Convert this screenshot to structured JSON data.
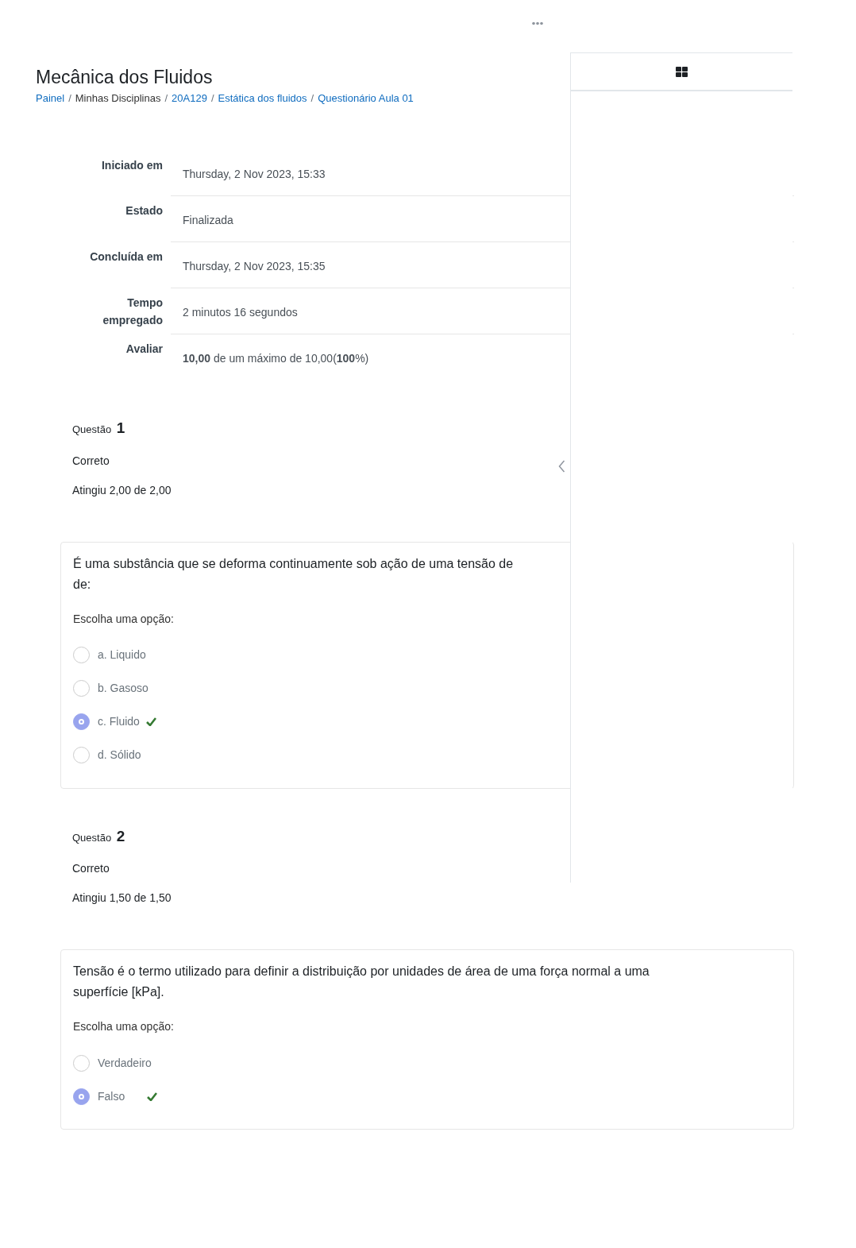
{
  "page_title": "Mecânica dos Fluidos",
  "breadcrumb": [
    {
      "text": "Painel",
      "link": true
    },
    {
      "separator": "/",
      "text": "Minhas Disciplinas",
      "link": false
    },
    {
      "separator": "/",
      "text": "20A129",
      "link": true
    },
    {
      "separator": "/",
      "text": "Estática dos fluidos",
      "link": true
    },
    {
      "separator": "/",
      "text": "Questionário Aula 01",
      "link": true
    }
  ],
  "summary": [
    {
      "label": "Iniciado em",
      "value": "Thursday, 2 Nov 2023, 15:33"
    },
    {
      "label": "Estado",
      "value": "Finalizada"
    },
    {
      "label": "Concluída em",
      "value": "Thursday, 2 Nov 2023, 15:35"
    },
    {
      "label": "Tempo empregado",
      "value": "2 minutos 16 segundos"
    },
    {
      "label": "Avaliar",
      "value": "**10,00** de um máximo de 10,00(**100**%)"
    }
  ],
  "questions": [
    {
      "number_label": "Questão",
      "number": "1",
      "status": "Correto",
      "grade": "Atingiu 2,00 de 2,00",
      "text_lines": [
        "É uma substância que se deforma continuamente sob ação de uma tensão de",
        "de:"
      ],
      "prompt": "Escolha uma opção:",
      "options": [
        {
          "label": "a. Liquido",
          "selected": false,
          "correct": false
        },
        {
          "label": "b. Gasoso",
          "selected": false,
          "correct": false
        },
        {
          "label": "c. Fluido",
          "selected": true,
          "correct": true
        },
        {
          "label": "d. Sólido",
          "selected": false,
          "correct": false
        }
      ]
    },
    {
      "number_label": "Questão",
      "number": "2",
      "status": "Correto",
      "grade": "Atingiu 1,50 de 1,50",
      "text_lines": [
        "Tensão é o termo utilizado para definir a distribuição por unidades de área de uma força normal a uma",
        "superfície [kPa]."
      ],
      "prompt": "Escolha uma opção:",
      "options": [
        {
          "label": "Verdadeiro",
          "selected": false,
          "correct": false
        },
        {
          "label": "Falso",
          "selected": true,
          "correct": true
        }
      ]
    }
  ]
}
